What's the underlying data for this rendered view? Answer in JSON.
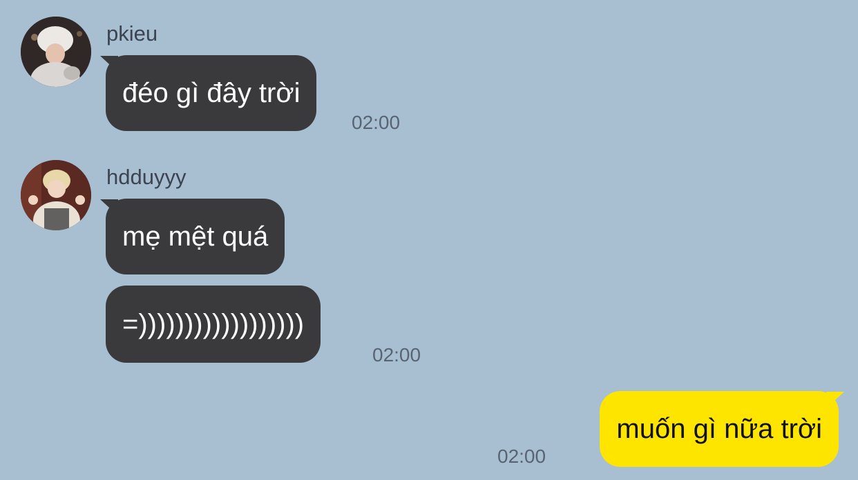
{
  "conversation": {
    "groups": [
      {
        "sender": "pkieu",
        "avatar_icon": "avatar-pkieu",
        "messages": [
          "đéo gì đây trời"
        ],
        "time": "02:00"
      },
      {
        "sender": "hdduyyy",
        "avatar_icon": "avatar-hdduyyy",
        "messages": [
          "mẹ mệt quá",
          "=))))))))))))))))))"
        ],
        "time": "02:00"
      }
    ],
    "outgoing": {
      "messages": [
        "muốn gì nữa trời"
      ],
      "time": "02:00"
    }
  },
  "colors": {
    "background": "#a8bfd2",
    "incoming_bubble": "#3a3a3c",
    "outgoing_bubble": "#fee500"
  }
}
